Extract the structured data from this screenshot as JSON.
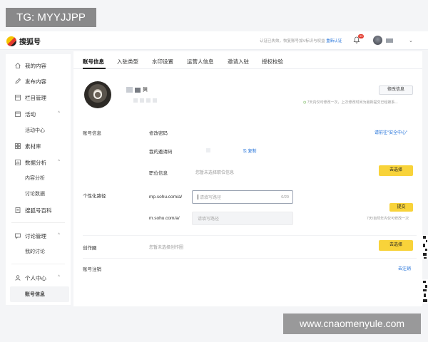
{
  "watermarks": {
    "top_left": "TG: MYYJJPP",
    "bottom_right": "www.cnaomenyule.com"
  },
  "header": {
    "logo_text": "搜狐号",
    "auth_note": "认证已失效，恢复账号加V标识与权益",
    "auth_link": "重新认证",
    "notif_badge": "99"
  },
  "sidebar": {
    "items": [
      {
        "label": "我的内容",
        "icon": "home-icon"
      },
      {
        "label": "发布内容",
        "icon": "pen-icon"
      },
      {
        "label": "栏目管理",
        "icon": "column-icon"
      },
      {
        "label": "活动",
        "icon": "calendar-icon",
        "caret": "^"
      },
      {
        "label": "活动中心",
        "sub": true
      },
      {
        "label": "素材库",
        "icon": "grid-icon"
      },
      {
        "label": "数据分析",
        "icon": "chart-icon",
        "caret": "^"
      },
      {
        "label": "内容分析",
        "sub": true
      },
      {
        "label": "讨论数据",
        "sub": true
      },
      {
        "label": "搜狐号百科",
        "icon": "book-icon"
      },
      {
        "label": "讨论管理",
        "icon": "chat-icon",
        "caret": "^"
      },
      {
        "label": "我的讨论",
        "sub": true
      },
      {
        "label": "个人中心",
        "icon": "user-icon",
        "caret": "^"
      },
      {
        "label": "账号信息",
        "sub": true,
        "active": true
      }
    ]
  },
  "tabs": [
    "账号信息",
    "入驻类型",
    "水印设置",
    "运营人信息",
    "邀请入驻",
    "授权校验"
  ],
  "profile": {
    "name_visible": "興",
    "edit_button": "修改信息",
    "edit_hint": "7天内仅可修改一次，上次修改时间为最新提交已经被系..."
  },
  "account": {
    "section_label": "账号信息",
    "change_password": "修改密码",
    "security_link": "请前往\"安全中心\"",
    "invite_code_label": "我的邀请码",
    "copy_link": "复制",
    "position_label": "职位信息",
    "position_placeholder": "您暂未选择职位信息",
    "choose_button": "去选择"
  },
  "custom_path": {
    "section_label": "个性化路径",
    "mp_label": "mp.sohu.com/a/",
    "mp_placeholder": "请填写路径",
    "mp_counter": "0/20",
    "m_label": "m.sohu.com/a/",
    "m_placeholder": "请填写路径",
    "submit_button": "提交",
    "submit_hint": "7天/自然年内仅可修改一次"
  },
  "circle": {
    "section_label": "创作圈",
    "placeholder": "您暂未选择创作圈",
    "choose_button": "去选择"
  },
  "cancel": {
    "section_label": "账号注销",
    "link": "去注销"
  }
}
